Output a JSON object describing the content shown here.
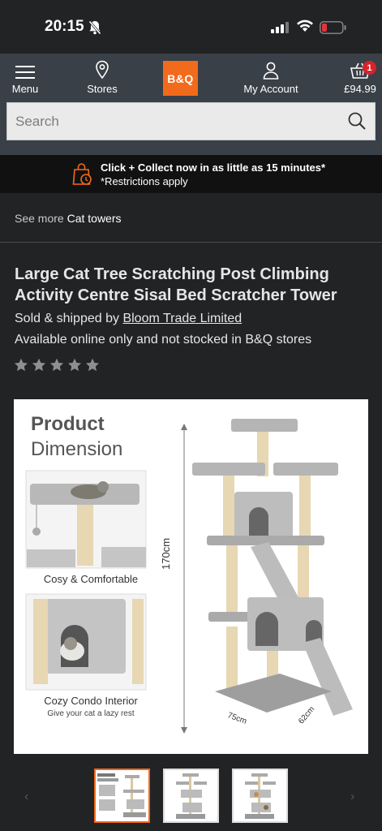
{
  "status_bar": {
    "time": "20:15"
  },
  "nav": {
    "menu_label": "Menu",
    "stores_label": "Stores",
    "logo_text": "B&Q",
    "account_label": "My Account",
    "basket_total": "£94.99",
    "basket_count": "1"
  },
  "search": {
    "placeholder": "Search"
  },
  "click_collect": {
    "line1": "Click + Collect now in as little as 15 minutes*",
    "line2": "*Restrictions apply"
  },
  "breadcrumb": {
    "prefix": "See more",
    "category": "Cat towers"
  },
  "product": {
    "title": "Large Cat Tree Scratching Post Climbing Activity Centre Sisal Bed Scratcher Tower",
    "sold_by_prefix": "Sold & shipped by",
    "seller": "Bloom Trade Limited",
    "availability": "Available online only and not stocked in B&Q stores",
    "rating_stars": 0,
    "rating_max": 5
  },
  "hero_image": {
    "heading_1": "Product",
    "heading_2": "Dimension",
    "caption_1": "Cosy & Comfortable",
    "caption_2": "Cozy Condo Interior",
    "caption_3": "Give your cat a lazy rest",
    "height_label": "170cm",
    "width_label": "75cm",
    "depth_label": "62cm"
  },
  "colors": {
    "brand_orange": "#f26a1b",
    "nav_bg": "#3a4047",
    "page_bg": "#222324",
    "badge_red": "#d8232a"
  }
}
